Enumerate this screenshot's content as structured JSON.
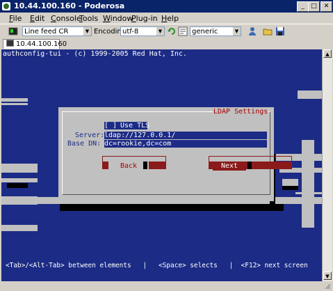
{
  "window": {
    "title": "10.44.100.160 - Poderosa",
    "minimize_glyph": "_",
    "maximize_glyph": "□",
    "close_glyph": "✕"
  },
  "menu": [
    "File",
    "Edit",
    "Console",
    "Tools",
    "Window",
    "Plug-in",
    "Help"
  ],
  "menu_mnemonics": [
    "F",
    "E",
    "C",
    "T",
    "W",
    "P",
    "H"
  ],
  "toolbar": {
    "newline_value": "Line feed CR",
    "encoding_label": "Encoding",
    "encoding_value": "utf-8",
    "terminal_type_value": "generic"
  },
  "tab": {
    "label": "10.44.100.160"
  },
  "terminal": {
    "header": "authconfig-tui - (c) 1999-2005 Red Hat, Inc.",
    "dialog_title": "LDAP Settings",
    "use_tls_checkbox": "[ ]",
    "use_tls_label": "Use TLS",
    "server_label": "Server:",
    "server_value": "ldap://127.0.0.1/",
    "base_dn_label": "Base DN:",
    "base_dn_value": "dc=rookie,dc=com",
    "back_button": "Back",
    "next_button": "Next",
    "help_line": "<Tab>/<Alt-Tab> between elements   |   <Space> selects   |  <F12> next screen"
  },
  "colors": {
    "terminal_bg": "#1c2b85",
    "dialog_bg": "#c0c0c0",
    "accent_red": "#8b1a1a",
    "title_red": "#aa0000"
  }
}
